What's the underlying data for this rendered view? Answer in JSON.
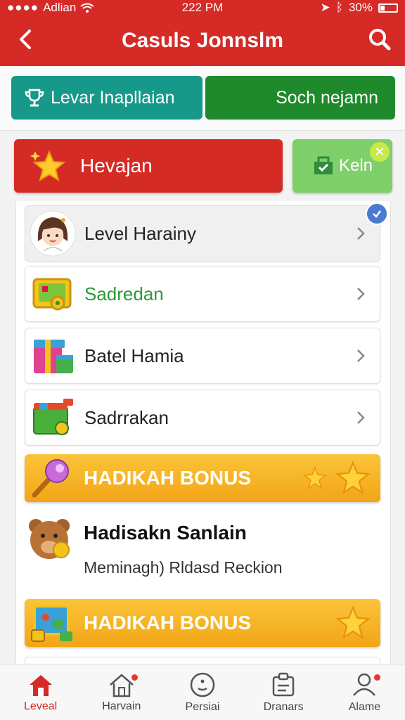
{
  "status_bar": {
    "carrier": "Adlian",
    "time": "222 PM",
    "battery": "30%"
  },
  "header": {
    "title": "Casuls Jonnslm"
  },
  "top_buttons": {
    "left_label": "Levar Inapllaian",
    "right_label": "Soch nejamn"
  },
  "row_two": {
    "main_label": "Hevajan",
    "side_label": "Keln"
  },
  "menu": {
    "items": [
      {
        "label": "Level Harainy"
      },
      {
        "label": "Sadredan"
      },
      {
        "label": "Batel Hamia"
      },
      {
        "label": "Sadrrakan"
      }
    ]
  },
  "bonus": [
    {
      "label": "HADIKAH BONUS"
    },
    {
      "label": "HADIKAH BONUS"
    }
  ],
  "reward": {
    "title": "Hadisakn Sanlain",
    "subtitle": "Meminagh) Rldasd Reckion"
  },
  "tabs": [
    {
      "label": "Leveal"
    },
    {
      "label": "Harvain"
    },
    {
      "label": "Persiai"
    },
    {
      "label": "Dranars"
    },
    {
      "label": "Alame"
    }
  ],
  "colors": {
    "primary": "#d62a26",
    "teal": "#17998a",
    "green": "#1f8a2c",
    "light_green": "#7fcf6a",
    "bonus": "#f2a516"
  }
}
